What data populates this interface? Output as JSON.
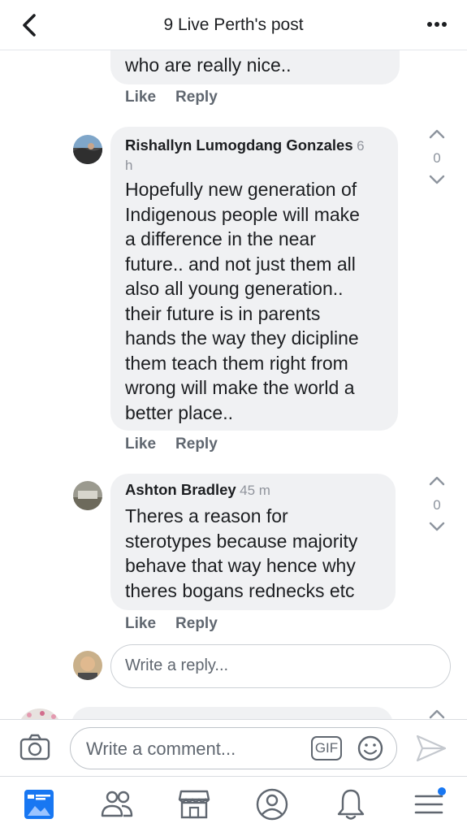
{
  "header": {
    "title": "9 Live Perth's post"
  },
  "comments": [
    {
      "lines": [
        "who are really nice.."
      ],
      "like": "Like",
      "reply": "Reply"
    },
    {
      "author": "Rishallyn Lumogdang Gonzales",
      "time_a": "6",
      "time_b": "h",
      "lines": [
        "Hopefully new generation of",
        "Indigenous people will make",
        "a difference in the near",
        "future.. and not just them all",
        "also all young generation..",
        "their future is in parents",
        "hands the way they dicipline",
        "them teach them right from",
        "wrong will make the world a",
        "better place.."
      ],
      "like": "Like",
      "reply": "Reply",
      "votes": "0"
    },
    {
      "author": "Ashton Bradley",
      "time": "45 m",
      "lines": [
        "Theres a reason for",
        "sterotypes because majority",
        "behave that way hence why",
        "theres bogans rednecks etc"
      ],
      "like": "Like",
      "reply": "Reply",
      "votes": "0"
    }
  ],
  "reply_input": {
    "placeholder": "Write a reply..."
  },
  "composer": {
    "placeholder": "Write a comment...",
    "gif_label": "GIF"
  },
  "icons": {
    "back": "chevron-left-icon",
    "more": "more-dots-icon",
    "camera": "camera-icon",
    "gif": "gif-icon",
    "emoji": "smiley-icon",
    "send": "send-icon",
    "news_feed": "news-feed-icon",
    "friends": "friends-icon",
    "marketplace": "marketplace-icon",
    "profile": "profile-icon",
    "notifications": "bell-icon",
    "menu": "menu-icon"
  },
  "colors": {
    "accent": "#1877f2",
    "bubble": "#f0f1f3",
    "icon_gray": "#606770"
  }
}
